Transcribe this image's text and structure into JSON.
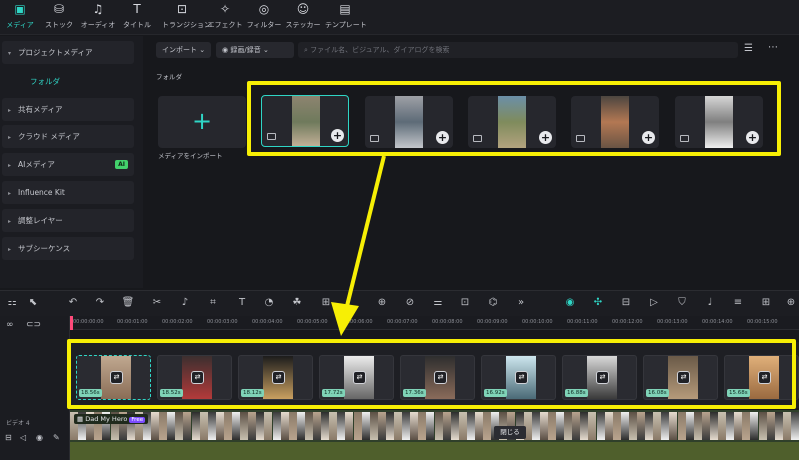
{
  "toolbar": {
    "items": [
      {
        "label": "メディア",
        "icon": "media-icon",
        "active": true
      },
      {
        "label": "ストック",
        "icon": "stock-icon"
      },
      {
        "label": "オーディオ",
        "icon": "audio-icon"
      },
      {
        "label": "タイトル",
        "icon": "title-icon"
      },
      {
        "label": "トランジション",
        "icon": "transition-icon"
      },
      {
        "label": "エフェクト",
        "icon": "effect-icon"
      },
      {
        "label": "フィルター",
        "icon": "filter-icon"
      },
      {
        "label": "ステッカー",
        "icon": "sticker-icon"
      },
      {
        "label": "テンプレート",
        "icon": "template-icon"
      }
    ]
  },
  "sidebar": {
    "project_media": "プロジェクトメディア",
    "folder": "フォルダ",
    "shared_media": "共有メディア",
    "cloud_media": "クラウド メディア",
    "ai_media": "AIメディア",
    "ai_badge": "AI",
    "influence_kit": "Influence Kit",
    "adjustment_layer": "調整レイヤー",
    "subsequence": "サブシーケンス"
  },
  "media": {
    "import_dropdown": "インポート",
    "record_dropdown": "録画/録音",
    "search_placeholder": "ファイル名、ビジュアル、ダイアログを検索",
    "folder_label": "フォルダ",
    "import_media_label": "メディアをインポート",
    "import_plus": "+",
    "card_plus": "+"
  },
  "timeline": {
    "ruler": [
      "00:00:00:00",
      "00:00:01:00",
      "00:00:02:00",
      "00:00:03:00",
      "00:00:04:00",
      "00:00:05:00",
      "00:00:06:00",
      "00:00:07:00",
      "00:00:08:00",
      "00:00:09:00",
      "00:00:10:00",
      "00:00:11:00",
      "00:00:12:00",
      "00:00:13:00",
      "00:00:14:00",
      "00:00:15:00"
    ],
    "clip_durations": [
      "18.56s",
      "18.52s",
      "18.12s",
      "17.72s",
      "17.36s",
      "16.92s",
      "16.88s",
      "16.08s",
      "15.68s"
    ],
    "video_track_label": "ビデオ 4",
    "video_clip_title": "Dad My Hero",
    "free_badge": "Free",
    "close_label": "閉じる"
  },
  "colors": {
    "accent": "#2fd6c6",
    "highlight": "#f7ef05",
    "ai_badge": "#43d16c",
    "duration_tag": "#7fd3b7"
  }
}
